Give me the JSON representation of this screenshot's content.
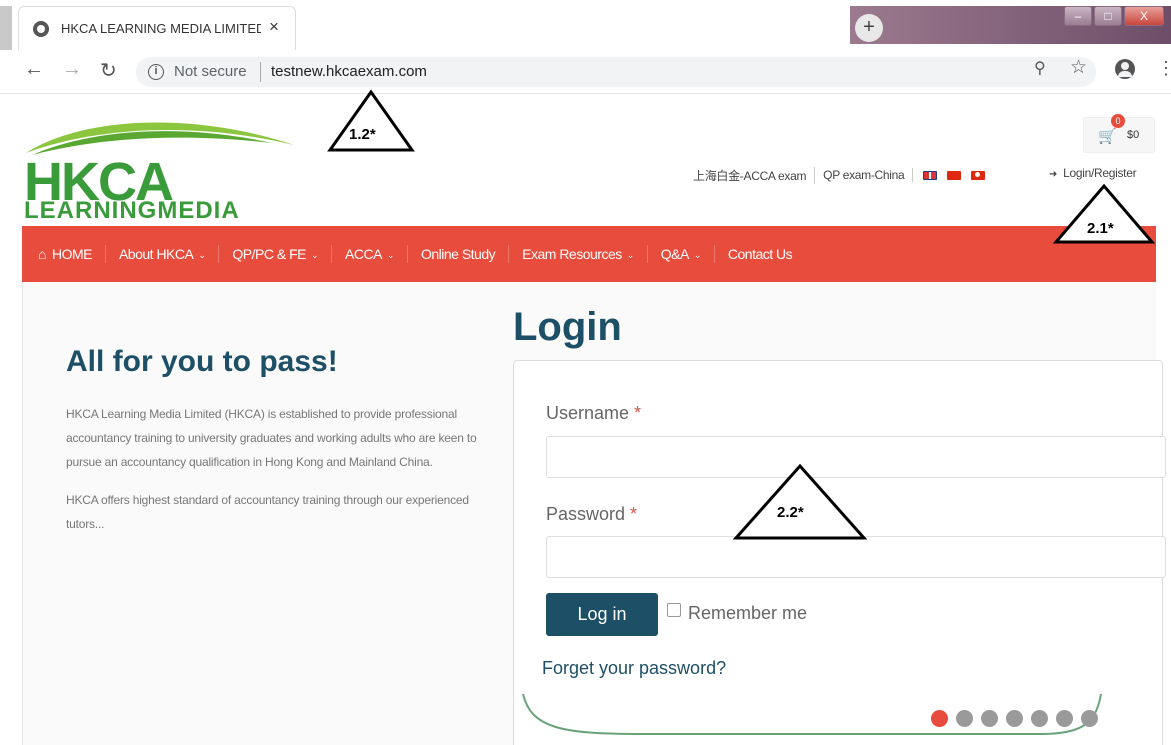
{
  "browser": {
    "tab_title": "HKCA LEARNING MEDIA LIMITED",
    "tab_close": "×",
    "new_tab": "+",
    "not_secure": "Not secure",
    "url": "testnew.hkcaexam.com",
    "window_minimize": "–",
    "window_maximize": "□",
    "window_close": "X"
  },
  "header": {
    "logo_main": "HKCA",
    "logo_sub": "LEARNINGMEDIA",
    "cart_count": "0",
    "cart_amount": "$0",
    "top_links": [
      "上海白金-ACCA exam",
      "QP exam-China"
    ],
    "login_register": "Login/Register"
  },
  "nav": {
    "items": [
      {
        "label": "HOME",
        "dropdown": false
      },
      {
        "label": "About HKCA",
        "dropdown": true
      },
      {
        "label": "QP/PC & FE",
        "dropdown": true
      },
      {
        "label": "ACCA",
        "dropdown": true
      },
      {
        "label": "Online Study",
        "dropdown": false
      },
      {
        "label": "Exam Resources",
        "dropdown": true
      },
      {
        "label": "Q&A",
        "dropdown": true
      },
      {
        "label": "Contact Us",
        "dropdown": false
      }
    ]
  },
  "left": {
    "title": "All for you to pass!",
    "para1": "HKCA Learning Media Limited (HKCA) is established to provide professional accountancy training to university graduates and working adults who are keen to pursue an accountancy qualification in Hong Kong and Mainland China.",
    "para2": "HKCA offers highest standard of accountancy training through our experienced tutors..."
  },
  "login": {
    "heading": "Login",
    "username_label": "Username",
    "password_label": "Password",
    "required_mark": "*",
    "username_value": "",
    "password_value": "",
    "submit_label": "Log in",
    "remember_label": "Remember me",
    "forgot_label": "Forget your password?"
  },
  "annotations": [
    "1.2*",
    "2.1*",
    "2.2*"
  ],
  "colors": {
    "accent_red": "#e74c3c",
    "brand_green": "#3a9b3a",
    "primary_dark": "#1d4f66"
  }
}
